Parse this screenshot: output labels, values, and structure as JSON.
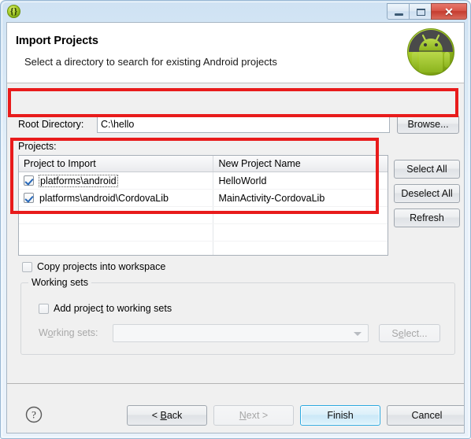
{
  "window": {
    "icon_name": "eclipse-braces-icon",
    "icon_glyph": "{}",
    "buttons": {
      "minimize": "minimize-icon",
      "maximize": "maximize-icon",
      "close_glyph": "✕"
    }
  },
  "header": {
    "title": "Import Projects",
    "subtitle": "Select a directory to search for existing Android projects",
    "badge_name": "android-robot-icon"
  },
  "root_directory": {
    "label": "Root Directory:",
    "value": "C:\\hello",
    "placeholder": "",
    "browse_label": "Browse..."
  },
  "projects": {
    "label": "Projects:",
    "columns": [
      "Project to Import",
      "New Project Name"
    ],
    "rows": [
      {
        "checked": true,
        "project": "platforms\\android",
        "new_name": "HelloWorld",
        "focused": true
      },
      {
        "checked": true,
        "project": "platforms\\android\\CordovaLib",
        "new_name": "MainActivity-CordovaLib",
        "focused": false
      }
    ],
    "empty_rows": 3,
    "side_buttons": [
      "Select All",
      "Deselect All",
      "Refresh"
    ]
  },
  "copy_projects": {
    "label": "Copy projects into workspace",
    "checked": false
  },
  "working_sets": {
    "group_title": "Working sets",
    "add_label_pre": "Add projec",
    "add_label_mnemonic": "t",
    "add_label_post": " to working sets",
    "add_checked": false,
    "combo_label_pre": "W",
    "combo_label_mnemonic": "o",
    "combo_label_post": "rking sets:",
    "combo_value": "",
    "select_label_pre": "S",
    "select_label_mnemonic": "e",
    "select_label_post": "lect..."
  },
  "footer": {
    "help_name": "help-question-icon",
    "back_pre": "< ",
    "back_mnemonic": "B",
    "back_post": "ack",
    "next_pre": "",
    "next_mnemonic": "N",
    "next_post": "ext >",
    "finish": "Finish",
    "cancel": "Cancel"
  },
  "colors": {
    "annotation_red": "#e81b1b",
    "default_button_blue": "#2aa9e0",
    "android_green": "#a4c639"
  }
}
